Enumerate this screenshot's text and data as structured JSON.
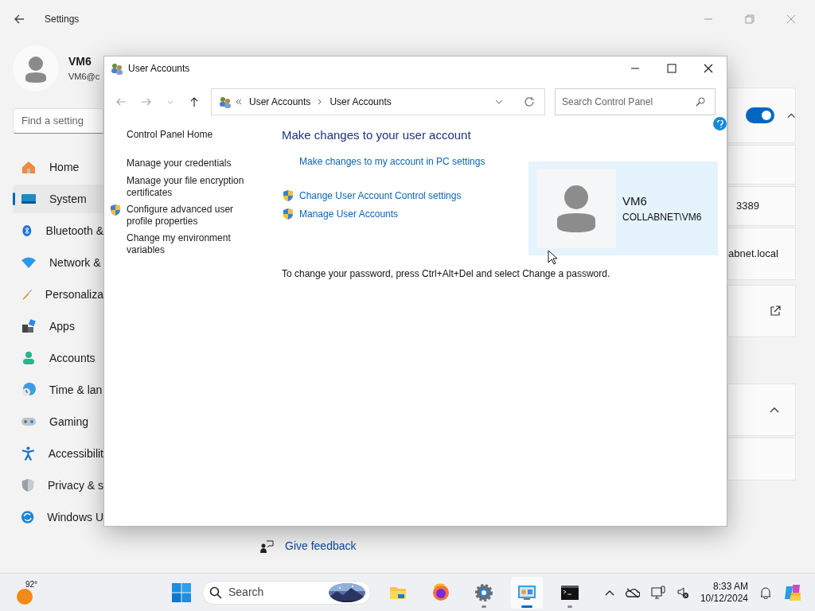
{
  "settings": {
    "title": "Settings",
    "user": {
      "name": "VM6",
      "email": "VM6@c"
    },
    "search": {
      "placeholder": "Find a setting"
    },
    "nav": [
      {
        "label": "Home",
        "selected": false
      },
      {
        "label": "System",
        "selected": true
      },
      {
        "label": "Bluetooth &",
        "selected": false
      },
      {
        "label": "Network &",
        "selected": false
      },
      {
        "label": "Personaliza",
        "selected": false
      },
      {
        "label": "Apps",
        "selected": false
      },
      {
        "label": "Accounts",
        "selected": false
      },
      {
        "label": "Time & lan",
        "selected": false
      },
      {
        "label": "Gaming",
        "selected": false
      },
      {
        "label": "Accessibilit",
        "selected": false
      },
      {
        "label": "Privacy & s",
        "selected": false
      },
      {
        "label": "Windows U",
        "selected": false
      }
    ],
    "remote_desktop": {
      "on": true,
      "port": "3389",
      "domain": "abnet.local"
    },
    "feedback": "Give feedback"
  },
  "dialog": {
    "title": "User Accounts",
    "breadcrumb": [
      "User Accounts",
      "User Accounts"
    ],
    "search": {
      "placeholder": "Search Control Panel"
    },
    "sidebar": [
      {
        "label": "Control Panel Home",
        "shield": false
      },
      {
        "label": "Manage your credentials",
        "shield": false
      },
      {
        "label": "Manage your file encryption certificates",
        "shield": false
      },
      {
        "label": "Configure advanced user profile properties",
        "shield": true
      },
      {
        "label": "Change my environment variables",
        "shield": false
      }
    ],
    "heading": "Make changes to your user account",
    "links": [
      {
        "label": "Make changes to my account in PC settings",
        "shield": false
      },
      {
        "label": "Change User Account Control settings",
        "shield": true
      },
      {
        "label": "Manage User Accounts",
        "shield": true
      }
    ],
    "account": {
      "name": "VM6",
      "domain": "COLLABNET\\VM6"
    },
    "note": "To change your password, press Ctrl+Alt+Del and select Change a password."
  },
  "taskbar": {
    "temperature": "92°",
    "search": {
      "placeholder": "Search"
    },
    "apps": [
      {
        "kind": "explorer",
        "selected": false,
        "running": false
      },
      {
        "kind": "firefox",
        "selected": false,
        "running": false
      },
      {
        "kind": "settings",
        "selected": false,
        "running": true
      },
      {
        "kind": "controlpanel",
        "selected": true,
        "running": true
      },
      {
        "kind": "terminal",
        "selected": false,
        "running": true
      }
    ],
    "time": "8:33 AM",
    "date": "10/12/2024"
  }
}
